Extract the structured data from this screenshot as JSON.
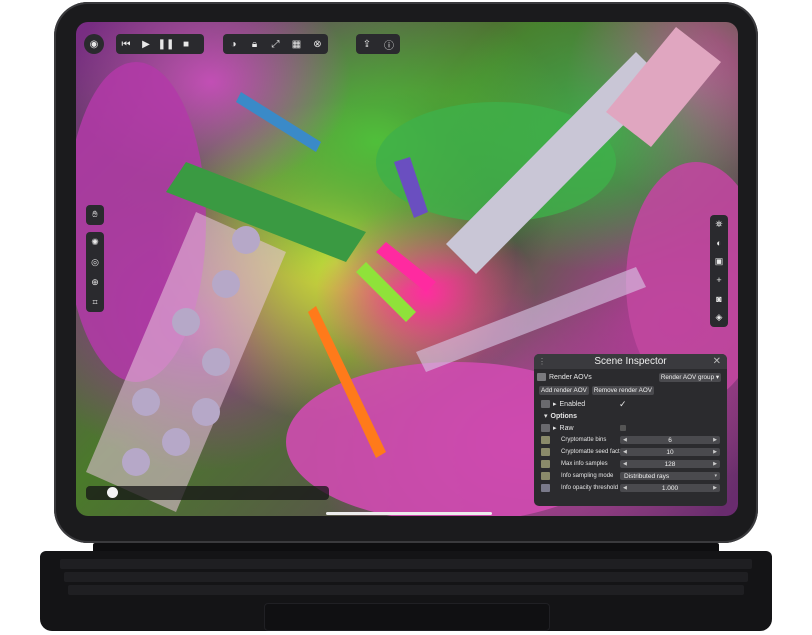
{
  "toolbar": {
    "group1": [
      "target-icon"
    ],
    "group2": [
      "skip-back-icon",
      "play-icon",
      "pause-icon",
      "stop-icon"
    ],
    "group3": [
      "toggle-icon",
      "lock-icon",
      "expand-icon",
      "checker-icon",
      "close-circle-icon"
    ],
    "group4": [
      "export-icon",
      "info-icon"
    ]
  },
  "left_sidebar": [
    "hand-icon",
    "sun-icon",
    "aperture-icon",
    "focus-icon",
    "crop-icon"
  ],
  "right_sidebar": [
    "light-icon",
    "material-icon",
    "display-icon",
    "add-icon",
    "camera-icon",
    "layers-icon"
  ],
  "timeline": {
    "progress": 0.04
  },
  "inspector": {
    "title": "Scene Inspector",
    "node_name": "Render AOVs",
    "group_select": "Render AOV group",
    "add_button": "Add render AOV",
    "remove_button": "Remove render AOV",
    "enabled_label": "Enabled",
    "enabled_checked": "✓",
    "options_label": "Options",
    "raw_label": "Raw",
    "params": [
      {
        "label": "Cryptomatte bins",
        "value": "6"
      },
      {
        "label": "Cryptomatte seed factor",
        "value": "10"
      },
      {
        "label": "Max info samples",
        "value": "128"
      },
      {
        "label": "Info sampling mode",
        "value": "Distributed rays"
      },
      {
        "label": "Info opacity threshold",
        "value": "1.000"
      }
    ]
  },
  "colors": {
    "panel_bg": "#2b2b2e",
    "device": "#1b1b1d"
  }
}
